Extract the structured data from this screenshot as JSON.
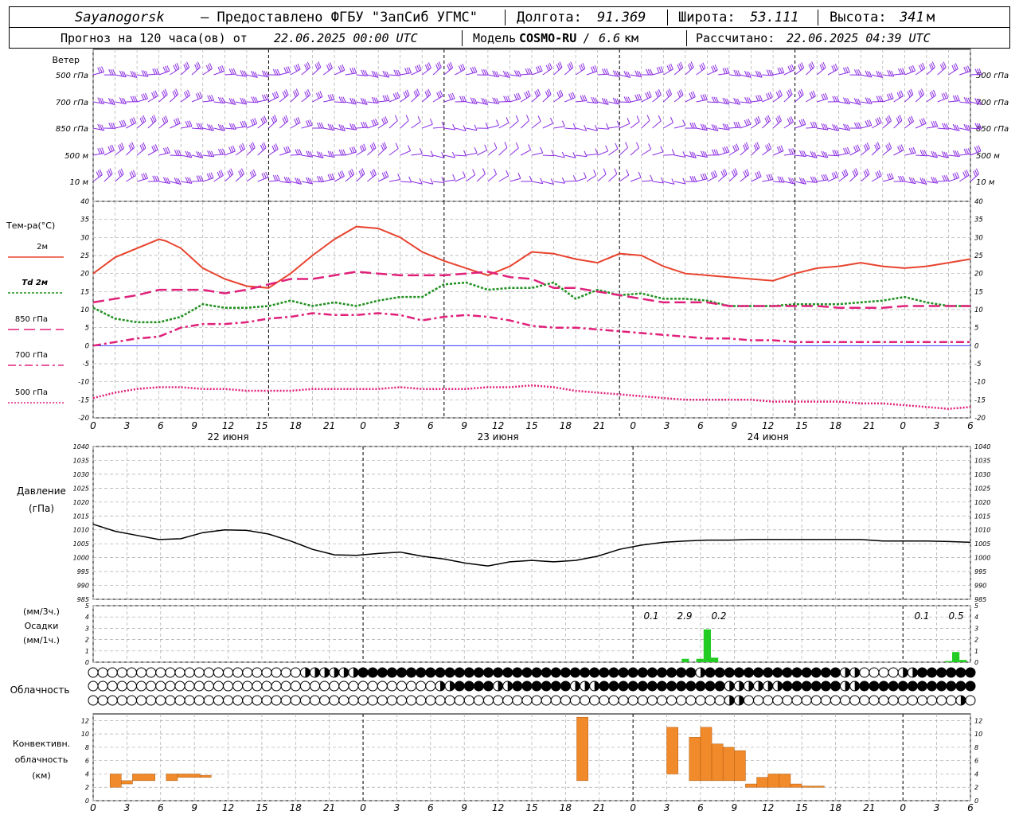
{
  "header": {
    "station": "Sayanogorsk",
    "provider": "— Предоставлено ФГБУ \"ЗапСиб УГМС\"",
    "lon_label": "Долгота:",
    "lon_value": "91.369",
    "lat_label": "Широта:",
    "lat_value": "53.111",
    "alt_label": "Высота:",
    "alt_value": "341",
    "alt_unit": "м",
    "forecast_prefix": "Прогноз на 120 часа(ов) от",
    "forecast_start": "22.06.2025 00:00 UTC",
    "model_label": "Модель",
    "model_name": "COSMO-RU",
    "model_res": "6.6",
    "model_res_unit": "км",
    "computed_label": "Рассчитано:",
    "computed_value": "22.06.2025 04:39 UTC"
  },
  "labels": {
    "wind_title": "Ветер",
    "wind_levels": [
      "500 гПа",
      "700 гПа",
      "850 гПа",
      "500 м",
      "10 м"
    ],
    "temp_title": "Тем-ра(°C)",
    "temp_legend": [
      "2м",
      "Td 2м",
      "850 гПа",
      "700 гПа",
      "500 гПа"
    ],
    "pressure_title": "Давление",
    "pressure_unit": "(гПа)",
    "precip_unit_top": "(мм/3ч.)",
    "precip_title": "Осадки",
    "precip_unit_bottom": "(мм/1ч.)",
    "cloud_title": "Облачность",
    "conv_title_1": "Конвективн.",
    "conv_title_2": "облачность",
    "conv_unit": "(км)"
  },
  "colors": {
    "t2m": "#e8432e",
    "td2m": "#1e8f1e",
    "t850": "#e0207a",
    "t700": "#e0207a",
    "t500": "#e0207a",
    "wind": "#8a2be2",
    "zero_line": "#3a3aff",
    "precip": "#22cc22",
    "convective": "#f08a2a",
    "grid": "#aaaaaa"
  },
  "time_axis": {
    "tick_labels": [
      "0",
      "3",
      "6",
      "9",
      "12",
      "15",
      "18",
      "21",
      "0",
      "3",
      "6",
      "9",
      "12",
      "15",
      "18",
      "21",
      "0",
      "3",
      "6",
      "9",
      "12",
      "15",
      "18",
      "21",
      "0",
      "3",
      "6"
    ],
    "day_labels": [
      "22 июня",
      "23 июня",
      "24 июня"
    ]
  },
  "chart_data": [
    {
      "type": "line",
      "name": "temperature",
      "x_unit": "hours since forecast start",
      "ylim": [
        -20,
        40
      ],
      "y_ticks": [
        -20,
        -15,
        -10,
        -5,
        0,
        5,
        10,
        15,
        20,
        25,
        30,
        35,
        40
      ],
      "grid": true,
      "series": [
        {
          "name": "2м",
          "x": [
            0,
            3,
            6,
            9,
            10,
            12,
            15,
            18,
            21,
            24,
            27,
            30,
            33,
            36,
            39,
            42,
            45,
            48,
            51,
            54,
            57,
            60,
            63,
            66,
            69,
            72,
            75,
            78,
            81,
            84,
            87,
            90,
            93,
            96,
            99,
            102,
            105,
            108,
            111,
            114,
            117,
            120
          ],
          "values": [
            20,
            24.5,
            27,
            29.5,
            29,
            27,
            21.5,
            18.5,
            16.5,
            16,
            20,
            25,
            29.5,
            33,
            32.5,
            30,
            26,
            23.5,
            21.5,
            19.5,
            22,
            26,
            25.5,
            24,
            23,
            25.5,
            25,
            22,
            20,
            19.5,
            19,
            18.5,
            18,
            20,
            21.5,
            22,
            23,
            22,
            21.5,
            22,
            23,
            24
          ]
        },
        {
          "name": "Td 2м",
          "x": [
            0,
            3,
            6,
            9,
            12,
            15,
            18,
            21,
            24,
            27,
            30,
            33,
            36,
            39,
            42,
            45,
            48,
            51,
            54,
            57,
            60,
            63,
            66,
            69,
            72,
            75,
            78,
            81,
            84,
            87,
            90,
            93,
            96,
            99,
            102,
            105,
            108,
            111,
            114,
            117,
            120
          ],
          "values": [
            10.5,
            7.5,
            6.5,
            6.5,
            8,
            11.5,
            10.5,
            10.5,
            11,
            12.5,
            11,
            12,
            11,
            12.5,
            13.5,
            13.5,
            17,
            17.5,
            15.5,
            16,
            16,
            17.5,
            13,
            15.5,
            14,
            14.5,
            13,
            13,
            12.5,
            11,
            11,
            11,
            11.5,
            11.5,
            11.5,
            12,
            12.5,
            13.5,
            12,
            11,
            11
          ]
        },
        {
          "name": "850 гПа",
          "x": [
            0,
            3,
            6,
            9,
            12,
            15,
            18,
            21,
            24,
            27,
            30,
            33,
            36,
            39,
            42,
            45,
            48,
            51,
            54,
            57,
            60,
            63,
            66,
            69,
            72,
            75,
            78,
            81,
            84,
            87,
            90,
            93,
            96,
            99,
            102,
            105,
            108,
            111,
            114,
            117,
            120
          ],
          "values": [
            12,
            13,
            14,
            15.5,
            15.5,
            15.5,
            14.5,
            15.5,
            17,
            18.5,
            18.5,
            19.5,
            20.5,
            20,
            19.5,
            19.5,
            19.5,
            20,
            20.5,
            19,
            18.5,
            16,
            16,
            15,
            14,
            13,
            12,
            12,
            12,
            11,
            11,
            11,
            11,
            11,
            10.5,
            10.5,
            10.5,
            11,
            11,
            11,
            11
          ]
        },
        {
          "name": "700 гПа",
          "x": [
            0,
            3,
            6,
            9,
            12,
            15,
            18,
            21,
            24,
            27,
            30,
            33,
            36,
            39,
            42,
            45,
            48,
            51,
            54,
            57,
            60,
            63,
            66,
            69,
            72,
            75,
            78,
            81,
            84,
            87,
            90,
            93,
            96,
            99,
            102,
            105,
            108,
            111,
            114,
            117,
            120
          ],
          "values": [
            0,
            1,
            2,
            2.5,
            5,
            6,
            6,
            6.5,
            7.5,
            8,
            9,
            8.5,
            8.5,
            9,
            8.5,
            7,
            8,
            8.5,
            8,
            7,
            5.5,
            5,
            5,
            4.5,
            4,
            3.5,
            3,
            2.5,
            2,
            2,
            1.5,
            1.5,
            1,
            1,
            1,
            1,
            1,
            1,
            1,
            1,
            1
          ]
        },
        {
          "name": "500 гПа",
          "x": [
            0,
            3,
            6,
            9,
            12,
            15,
            18,
            21,
            24,
            27,
            30,
            33,
            36,
            39,
            42,
            45,
            48,
            51,
            54,
            57,
            60,
            63,
            66,
            69,
            72,
            75,
            78,
            81,
            84,
            87,
            90,
            93,
            96,
            99,
            102,
            105,
            108,
            111,
            114,
            117,
            120
          ],
          "values": [
            -14.5,
            -13,
            -12,
            -11.5,
            -11.5,
            -12,
            -12,
            -12.5,
            -12.5,
            -12.5,
            -12,
            -12,
            -12,
            -12,
            -11.5,
            -12,
            -12,
            -12,
            -11.5,
            -11.5,
            -11,
            -11.5,
            -12.5,
            -13,
            -13.5,
            -14,
            -14.5,
            -15,
            -15,
            -15,
            -15,
            -15.5,
            -15.5,
            -15.5,
            -15.5,
            -16,
            -16,
            -16.5,
            -17,
            -17.5,
            -17
          ]
        }
      ]
    },
    {
      "type": "line",
      "name": "pressure",
      "x_unit": "hours since forecast start",
      "ylim": [
        985,
        1040
      ],
      "y_ticks": [
        985,
        990,
        995,
        1000,
        1005,
        1010,
        1015,
        1020,
        1025,
        1030,
        1035,
        1040
      ],
      "grid": true,
      "series": [
        {
          "name": "Давление",
          "x": [
            0,
            3,
            6,
            9,
            12,
            15,
            18,
            21,
            24,
            27,
            30,
            33,
            36,
            39,
            42,
            45,
            48,
            51,
            54,
            57,
            60,
            63,
            66,
            69,
            72,
            75,
            78,
            81,
            84,
            87,
            90,
            93,
            96,
            99,
            102,
            105,
            108,
            111,
            114,
            117,
            120
          ],
          "values": [
            1012,
            1009.5,
            1008,
            1006.5,
            1006.8,
            1009,
            1010,
            1009.8,
            1008.5,
            1006,
            1003,
            1001,
            1000.8,
            1001.5,
            1002,
            1000.5,
            999.5,
            998,
            997,
            998.5,
            999,
            998.5,
            999,
            1000.5,
            1003,
            1004.5,
            1005.5,
            1006,
            1006.3,
            1006.3,
            1006.5,
            1006.5,
            1006.5,
            1006.5,
            1006.5,
            1006.5,
            1006,
            1006,
            1006,
            1005.8,
            1005.5
          ]
        }
      ]
    },
    {
      "type": "bar",
      "name": "precipitation",
      "x_unit": "hours since forecast start",
      "ylim": [
        0,
        5
      ],
      "y_ticks": [
        0,
        1,
        2,
        3,
        4,
        5
      ],
      "bars": [
        {
          "x": 81,
          "value": 0.3
        },
        {
          "x": 83,
          "value": 0.3
        },
        {
          "x": 84,
          "value": 2.9
        },
        {
          "x": 85,
          "value": 0.4
        },
        {
          "x": 117,
          "value": 0.1
        },
        {
          "x": 118,
          "value": 0.9
        },
        {
          "x": 119,
          "value": 0.2
        }
      ],
      "totals_3h": [
        {
          "x": 80,
          "text": "0.1"
        },
        {
          "x": 83,
          "text": "2.9"
        },
        {
          "x": 86,
          "text": "0.2"
        },
        {
          "x": 110,
          "text": "0.1"
        },
        {
          "x": 113,
          "text": "0.5"
        }
      ]
    },
    {
      "type": "bar",
      "name": "convective_cloud",
      "x_unit": "hours since forecast start",
      "ylim": [
        0,
        12
      ],
      "y_ticks": [
        0,
        2,
        4,
        6,
        8,
        10,
        12
      ],
      "bars": [
        {
          "x0": 1.5,
          "x1": 2.5,
          "bottom": 2,
          "top": 4
        },
        {
          "x0": 2.5,
          "x1": 3.5,
          "bottom": 2.5,
          "top": 3
        },
        {
          "x0": 3.5,
          "x1": 5.5,
          "bottom": 3,
          "top": 4
        },
        {
          "x0": 6.5,
          "x1": 7.5,
          "bottom": 3,
          "top": 4
        },
        {
          "x0": 7.5,
          "x1": 9.5,
          "bottom": 3.5,
          "top": 4
        },
        {
          "x0": 9.5,
          "x1": 10.5,
          "bottom": 3.5,
          "top": 3.8
        },
        {
          "x0": 43,
          "x1": 44,
          "bottom": 3,
          "top": 12.5
        },
        {
          "x0": 51,
          "x1": 52,
          "bottom": 4,
          "top": 11
        },
        {
          "x0": 53,
          "x1": 54,
          "bottom": 3,
          "top": 9.5
        },
        {
          "x0": 54,
          "x1": 55,
          "bottom": 3,
          "top": 11
        },
        {
          "x0": 55,
          "x1": 56,
          "bottom": 3,
          "top": 8.5
        },
        {
          "x0": 56,
          "x1": 57,
          "bottom": 3,
          "top": 8
        },
        {
          "x0": 57,
          "x1": 58,
          "bottom": 3,
          "top": 7.5
        },
        {
          "x0": 58,
          "x1": 59,
          "bottom": 2,
          "top": 2.5
        },
        {
          "x0": 59,
          "x1": 60,
          "bottom": 2,
          "top": 3.5
        },
        {
          "x0": 60,
          "x1": 61,
          "bottom": 2,
          "top": 4
        },
        {
          "x0": 61,
          "x1": 62,
          "bottom": 2,
          "top": 4
        },
        {
          "x0": 62,
          "x1": 63,
          "bottom": 2,
          "top": 2.5
        },
        {
          "x0": 63,
          "x1": 65,
          "bottom": 2,
          "top": 2.2
        },
        {
          "x0": 95,
          "x1": 96,
          "bottom": 1.5,
          "top": 5.5
        },
        {
          "x0": 96,
          "x1": 97,
          "bottom": 1.5,
          "top": 9
        },
        {
          "x0": 97,
          "x1": 98,
          "bottom": 1.5,
          "top": 10
        },
        {
          "x0": 98,
          "x1": 99,
          "bottom": 1.5,
          "top": 9
        }
      ]
    }
  ],
  "cloud_cover": {
    "rows": [
      "0000000000000000000000ZZZZZZ88888888888888888888888888888888888Z88888888888888ZZ0000ZZ888888",
      "000000000000000000000000000000000000ZZ8888ZZ888888ZZZ8888888888888ZZZZZZ888888ZZ888888888888",
      "000000000000000000000000000000000000000000000000000000000000000000ZZ0000000000000000000000Z0"
    ]
  }
}
